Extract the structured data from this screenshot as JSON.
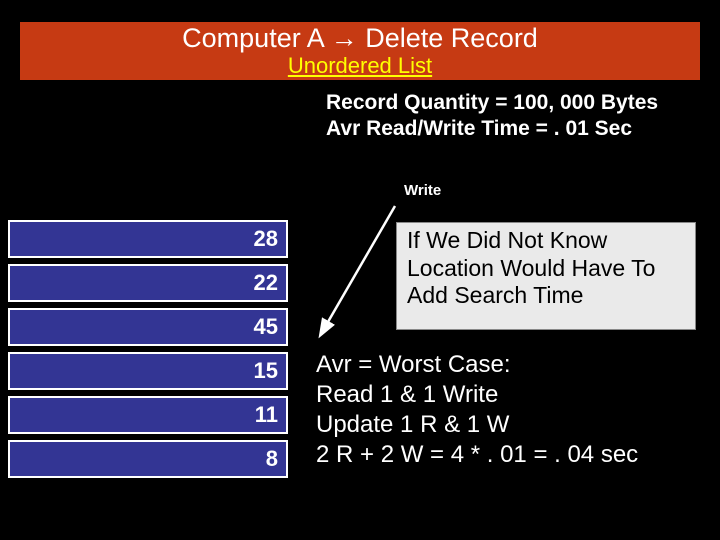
{
  "header": {
    "title": "Computer A → Delete Record",
    "subtitle": "Unordered List"
  },
  "meta": {
    "line1": "Record  Quantity =  100, 000 Bytes",
    "line2": "Avr Read/Write Time = . 01 Sec"
  },
  "write_label": "Write",
  "records": [
    {
      "value": "28"
    },
    {
      "value": "22"
    },
    {
      "value": "45"
    },
    {
      "value": "15"
    },
    {
      "value": "11"
    },
    {
      "value": "8"
    }
  ],
  "note": "If We Did Not Know Location Would Have To Add Search Time",
  "calc": {
    "l1": "Avr = Worst Case:",
    "l2": "Read 1  & 1 Write",
    "l3": "Update 1 R & 1 W",
    "l4": "2 R + 2 W  = 4 * . 01  = . 04 sec"
  }
}
